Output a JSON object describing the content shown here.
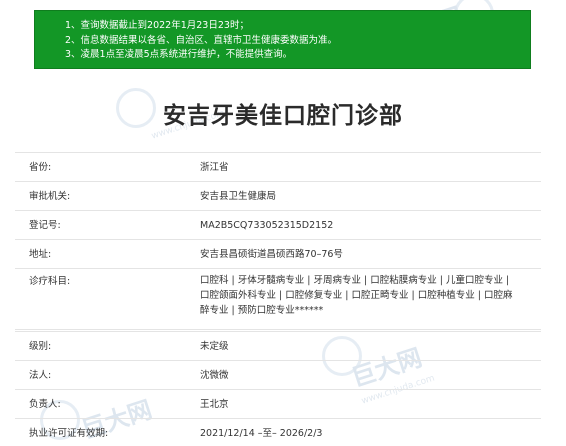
{
  "notice": {
    "lines": [
      "1、查询数据截止到2022年1月23日23时；",
      "2、信息数据结果以各省、自治区、直辖市卫生健康委数据为准。",
      "3、凌晨1点至凌晨5点系统进行维护，不能提供查询。"
    ]
  },
  "watermark": {
    "brand": "巨大网",
    "url": "www.cnjuda.com"
  },
  "title": "安吉牙美佳口腔门诊部",
  "fields": [
    {
      "label": "省份:",
      "value": "浙江省"
    },
    {
      "label": "审批机关:",
      "value": "安吉县卫生健康局"
    },
    {
      "label": "登记号:",
      "value": "MA2B5CQ733052315D2152"
    },
    {
      "label": "地址:",
      "value": "安吉县昌硕街道昌硕西路70–76号"
    },
    {
      "label": "诊疗科目:",
      "value": "口腔科 | 牙体牙髓病专业 | 牙周病专业 | 口腔粘膜病专业 | 儿童口腔专业 | 口腔颌面外科专业 | 口腔修复专业 | 口腔正畸专业 | 口腔种植专业 | 口腔麻醉专业 | 预防口腔专业******"
    },
    {
      "label": "级别:",
      "value": "未定级"
    },
    {
      "label": "法人:",
      "value": "沈微微"
    },
    {
      "label": "负责人:",
      "value": "王北京"
    },
    {
      "label": "执业许可证有效期:",
      "value": "2021/12/14 –至– 2026/2/3"
    }
  ]
}
